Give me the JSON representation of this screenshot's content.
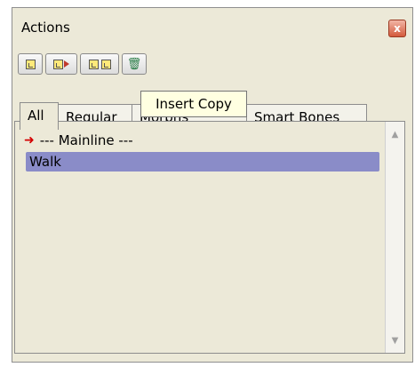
{
  "panel": {
    "title": "Actions",
    "close_label": "x"
  },
  "toolbar": {
    "buttons": [
      {
        "name": "new-action",
        "icon": "new-action-icon"
      },
      {
        "name": "insert-action",
        "icon": "insert-action-icon"
      },
      {
        "name": "insert-copy",
        "icon": "insert-copy-icon"
      },
      {
        "name": "delete-action",
        "icon": "trash-icon"
      }
    ]
  },
  "tooltip": {
    "text": "Insert Copy"
  },
  "tabs": [
    {
      "label": "All",
      "active": true
    },
    {
      "label": "Regular",
      "active": false
    },
    {
      "label": "Morphs",
      "active": false
    },
    {
      "label": "Smart Bones",
      "active": false
    }
  ],
  "list": {
    "items": [
      {
        "label": "--- Mainline ---",
        "icon": "red-arrow-icon"
      },
      {
        "label": "Walk",
        "selected": true
      }
    ]
  },
  "colors": {
    "panel_bg": "#ece9d8",
    "selection": "#8a8cc8",
    "tooltip_bg": "#ffffe1",
    "close_button": "#d35a3c"
  }
}
